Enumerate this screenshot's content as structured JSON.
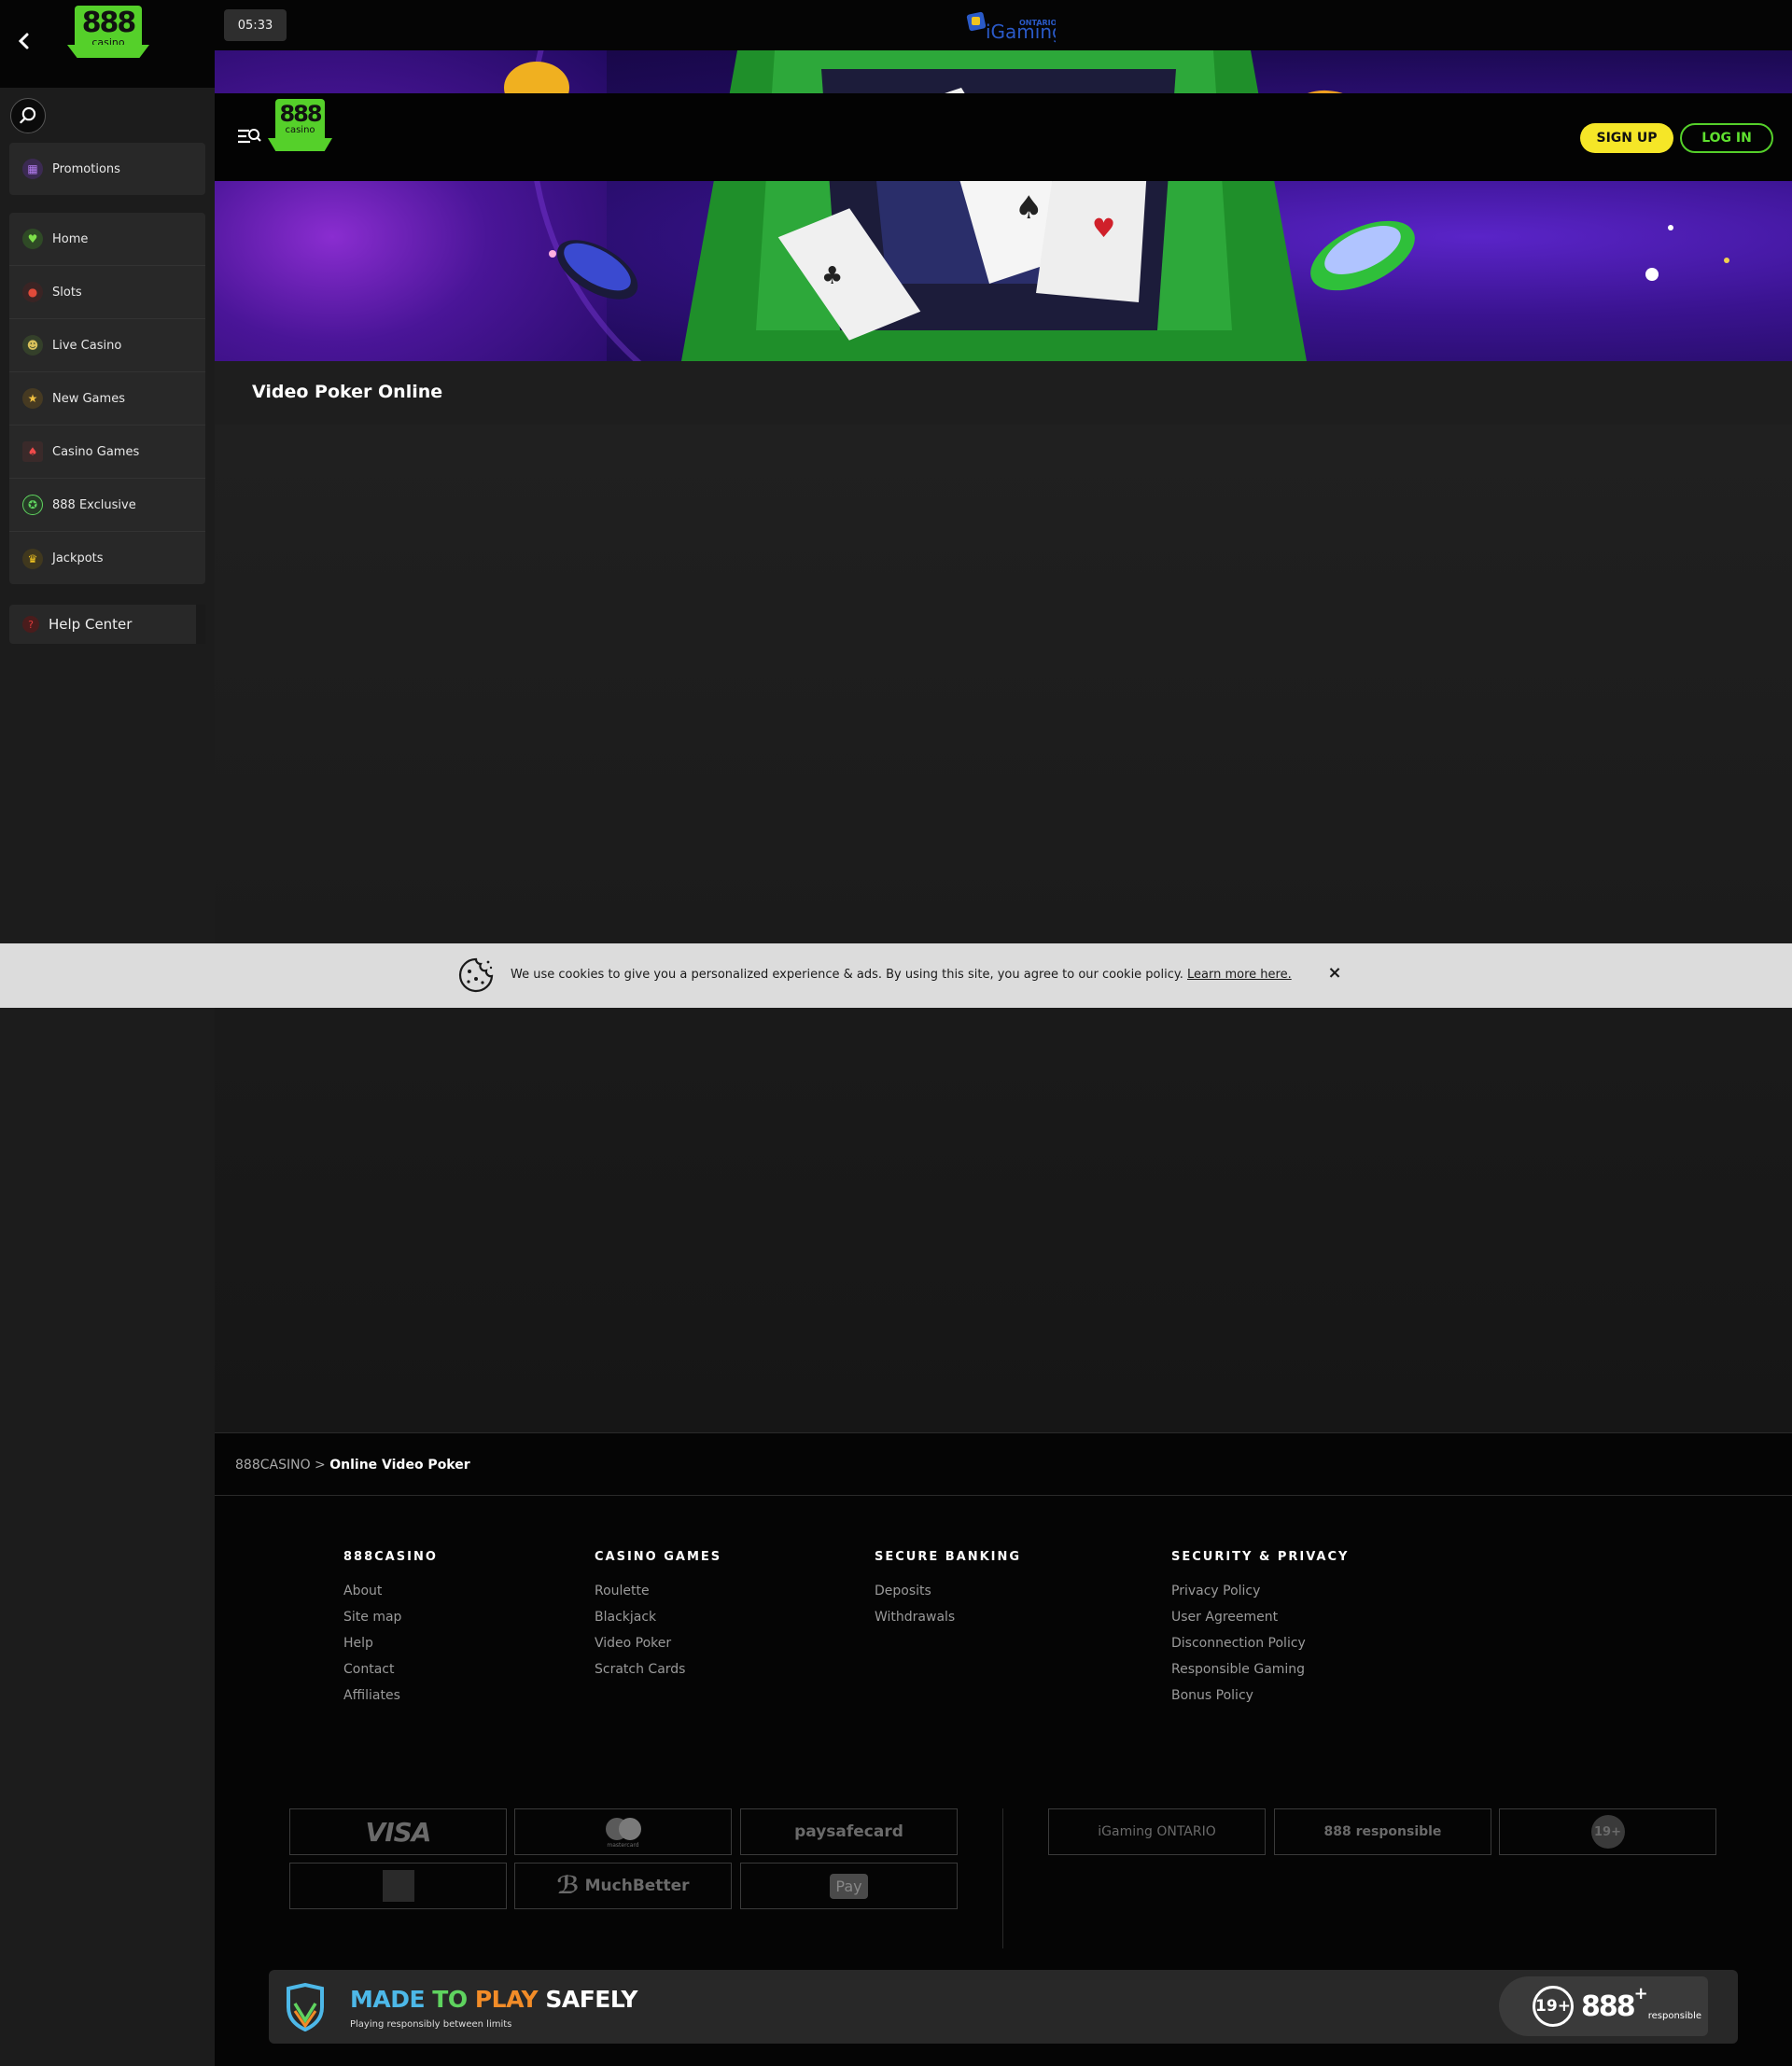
{
  "header": {
    "clock": "05:33",
    "signup_label": "SIGN UP",
    "login_label": "LOG IN"
  },
  "logo": {
    "number": "888",
    "word": "casino"
  },
  "regulator": {
    "name": "iGaming",
    "region": "ONTARIO"
  },
  "sidebar": {
    "promo": {
      "label": "Promotions",
      "icon": "gift-icon"
    },
    "items": [
      {
        "label": "Home",
        "icon": "heart-icon"
      },
      {
        "label": "Slots",
        "icon": "cherry-icon"
      },
      {
        "label": "Live Casino",
        "icon": "dealer-icon"
      },
      {
        "label": "New Games",
        "icon": "star-icon"
      },
      {
        "label": "Casino Games",
        "icon": "cards-icon"
      },
      {
        "label": "888 Exclusive",
        "icon": "badge-icon"
      },
      {
        "label": "Jackpots",
        "icon": "trophy-icon"
      }
    ],
    "help": {
      "label": "Help Center",
      "icon": "question-icon"
    }
  },
  "page": {
    "title": "Video Poker Online"
  },
  "cookie": {
    "text": "We use cookies to give you a personalized experience & ads. By using this site, you agree to our cookie policy.",
    "link": "Learn more here.",
    "close": "×"
  },
  "breadcrumb": {
    "root": "888CASINO",
    "sep": ">",
    "current": "Online Video Poker"
  },
  "footer": {
    "columns": [
      {
        "heading": "888CASINO",
        "links": [
          "About",
          "Site map",
          "Help",
          "Contact",
          "Affiliates"
        ]
      },
      {
        "heading": "CASINO GAMES",
        "links": [
          "Roulette",
          "Blackjack",
          "Video Poker",
          "Scratch Cards"
        ]
      },
      {
        "heading": "SECURE BANKING",
        "links": [
          "Deposits",
          "Withdrawals"
        ]
      },
      {
        "heading": "SECURITY & PRIVACY",
        "links": [
          "Privacy Policy",
          "User Agreement",
          "Disconnection Policy",
          "Responsible Gaming",
          "Bonus Policy"
        ]
      }
    ],
    "payments": [
      "VISA",
      "mastercard",
      "paysafecard",
      "",
      "MuchBetter",
      "Pay"
    ],
    "trust": [
      "iGaming ONTARIO",
      "888 responsible",
      "19+"
    ]
  },
  "safe": {
    "made": "MADE",
    "to": "TO",
    "play": "PLAY",
    "safely": "SAFELY",
    "sub": "Playing responsibly between limits",
    "age": "19+",
    "brand": "888",
    "plus": "+",
    "resp": "responsible"
  },
  "colors": {
    "brand_green": "#55d02a",
    "signup_yellow": "#f5e627",
    "made_blue": "#4db8e8",
    "to_green": "#5fd35f",
    "play_orange": "#f28c28"
  }
}
